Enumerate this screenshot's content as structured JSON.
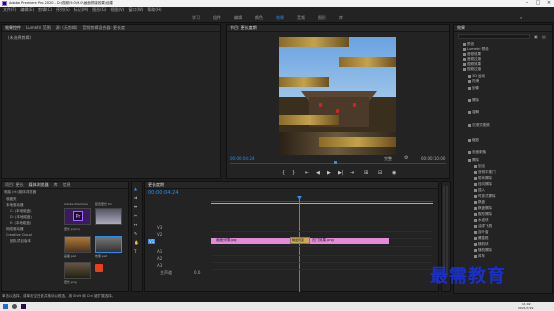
{
  "title_bar": {
    "app_title": "Adobe Premiere Pro 2020 - D:\\视频\\9.0\\9.0\\画面拼接效果\\创建"
  },
  "menu": [
    "文件(F)",
    "编辑(E)",
    "剪辑(C)",
    "序列(S)",
    "标记(M)",
    "图形(G)",
    "视图(V)",
    "窗口(W)",
    "帮助(H)"
  ],
  "workspaces": [
    "学习",
    "组件",
    "编辑",
    "颜色",
    "效果",
    "音频",
    "图形",
    "库"
  ],
  "active_workspace": "效果",
  "source_panel": {
    "tabs": [
      "效果控件",
      "Lumetri 范围",
      "源: (无剪辑)",
      "音频剪辑混合器: 更长度"
    ],
    "selection_text": "(未选择剪辑)"
  },
  "program_panel": {
    "title": "节目: 更长度期",
    "current_time": "00:00:04:24",
    "fit": "完整",
    "duration": "00:00:10:00"
  },
  "project_panel": {
    "tabs": [
      "项目: 更长",
      "媒体浏览器",
      "库",
      "信息"
    ],
    "path": "电脑 (H:)媒体浏览器",
    "tree": [
      "收藏夹",
      "本地驱动器",
      "C: (本地磁盘)",
      "D: (本地磁盘)",
      "E: (本地磁盘)",
      "网络驱动器",
      "Creative Cloud",
      "团队项目版本"
    ],
    "thumbs": [
      {
        "name": "Adobe Premiere",
        "sub": "更长.prproj"
      },
      {
        "name": "配置更长.fm",
        "sub": ""
      },
      {
        "name": "画面.psd",
        "sub": ""
      },
      {
        "name": "效果.psd",
        "sub": ""
      },
      {
        "name": "更长.png",
        "sub": ""
      }
    ]
  },
  "timeline_panel": {
    "title": "更长度期",
    "current_time": "00:00:04:24",
    "tracks": [
      "V3",
      "V2",
      "V1",
      "A1",
      "A2",
      "A3",
      "主声道"
    ],
    "clip_a": "画面分隔.jpg",
    "clip_transition": "棋盘划变",
    "clip_b": "石门效果.png",
    "master_value": "0.0"
  },
  "effects_panel": {
    "title": "效果",
    "search_placeholder": "",
    "tree": [
      "预设",
      "Lumetri 预设",
      "音频效果",
      "音频过渡",
      "视频效果",
      "视频过渡",
      "3D 运动",
      "内滑",
      "划像",
      "擦除",
      "溶解",
      "沉浸式视频",
      "缩放",
      "页面剥落",
      "擦除",
      "划出",
      "双侧平推门",
      "带状擦除",
      "径向擦除",
      "插入",
      "时钟式擦除",
      "棋盘",
      "棋盘擦除",
      "楔形擦除",
      "水波块",
      "油漆飞溅",
      "百叶窗",
      "螺旋框",
      "随机块",
      "随机擦除",
      "风车"
    ]
  },
  "status_bar": {
    "text": "单击以选择，或单击空白处并拖动以框选，用 Shift 和 Ctrl 键扩展选择。"
  },
  "taskbar": {
    "time": "11:02",
    "date": "2021/7/29"
  },
  "watermark": {
    "text": "最需教育"
  },
  "colors": {
    "accent_blue": "#2d8ceb",
    "clip_pink": "#e38ad9",
    "transition": "#c8a85a"
  }
}
